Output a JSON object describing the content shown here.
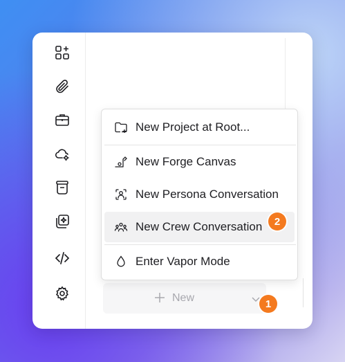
{
  "sidebar": {
    "icons": [
      {
        "name": "apps-add-icon"
      },
      {
        "name": "paperclip-icon"
      },
      {
        "name": "briefcase-icon"
      },
      {
        "name": "cloud-settings-icon"
      },
      {
        "name": "archive-jar-icon"
      },
      {
        "name": "sparkle-layers-icon"
      },
      {
        "name": "code-icon"
      },
      {
        "name": "gear-icon"
      }
    ]
  },
  "menu": {
    "items": [
      {
        "label": "New Project at Root...",
        "icon": "folder-plus-icon"
      },
      {
        "label": "New Forge Canvas",
        "icon": "canvas-pen-icon"
      },
      {
        "label": "New Persona Conversation",
        "icon": "persona-icon"
      },
      {
        "label": "New Crew Conversation",
        "icon": "crew-icon",
        "highlighted": true
      },
      {
        "label": "Enter Vapor Mode",
        "icon": "droplet-icon"
      }
    ]
  },
  "new_button": {
    "label": "New",
    "plus_icon": "plus-icon",
    "chevron_icon": "chevron-down-icon"
  },
  "badges": {
    "one": "1",
    "two": "2"
  },
  "colors": {
    "badge": "#f47a1f",
    "hover": "#f1f1f2",
    "text": "#1e1e22",
    "muted": "#a8a8ae"
  }
}
